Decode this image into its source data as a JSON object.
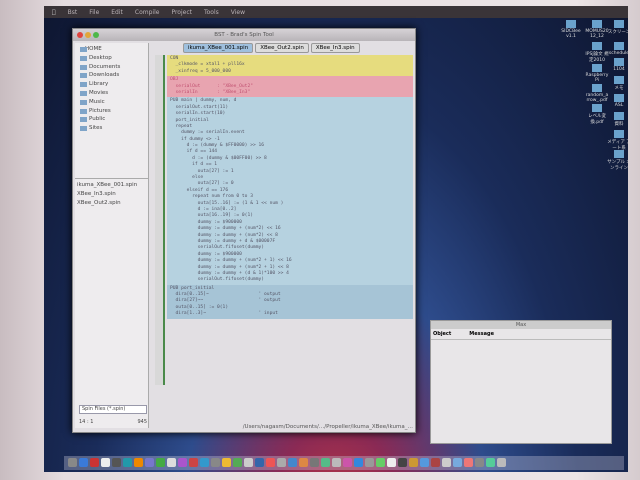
{
  "menubar": {
    "items": [
      "Bst",
      "File",
      "Edit",
      "Compile",
      "Project",
      "Tools",
      "View"
    ]
  },
  "window": {
    "title": "BST - Brad's Spin Tool",
    "tabs": [
      {
        "label": "ikuma_XBee_001.spin",
        "active": true
      },
      {
        "label": "XBee_Out2.spin"
      },
      {
        "label": "XBee_In3.spin"
      }
    ],
    "tree": {
      "root": "HOME",
      "items": [
        "Desktop",
        "Documents",
        "Downloads",
        "Library",
        "Movies",
        "Music",
        "Pictures",
        "Public",
        "Sites"
      ]
    },
    "files": [
      "ikuma_XBee_001.spin",
      "XBee_In3.spin",
      "XBee_Out2.spin"
    ],
    "filter": "Spin Files (*.spin)",
    "cursor": "14 : 1",
    "size": "945",
    "path": "/Users/nagasm/Documents/…/Propeller/ikuma_XBee/ikuma_…",
    "code": {
      "con": [
        "CON",
        "  _clkmode = xtal1 + pll16x",
        "  _xinfreq = 5_000_000"
      ],
      "obj": [
        "OBJ",
        "  serialOut      : \"XBee_Out2\"",
        "  serialIn       : \"XBee_In3\""
      ],
      "pub": [
        "PUB main | dummy, num, d",
        "  serialOut.start(11)",
        "  serialIn.start(10)",
        "  port_initial",
        "  repeat",
        "    dummy := serialIn.event",
        "    if dummy <> -1",
        "      d := (dummy & $FF0000) >> 16",
        "      if d == 144",
        "        d := (dummy & $00FF00) >> 8",
        "        if d == 1",
        "          outa[27] := 1",
        "        else",
        "          outa[27] := 0",
        "      elseif d == 176",
        "        repeat num from 0 to 3",
        "          outa[15..16] := (1 & 1 << num )",
        "          d := ina[0..2]",
        "          outa[16..19] := 0(1)",
        "          dummy := $900000",
        "          dummy := dummy + (num*2) << 16",
        "          dummy := dummy + (num*2) << 8",
        "          dummy := dummy + d & $00007F",
        "          serialOut.fifoset(dummy)",
        "          dummy := $900000",
        "          dummy := dummy + (num*2 + 1) << 16",
        "          dummy := dummy + (num*2 + 1) << 8",
        "          dummy := dummy + (d & 1)*100 >> 4",
        "          serialOut.fifoset(dummy)"
      ],
      "pri": [
        "PUB port_initial",
        "  dira[0..15]~                  ' output",
        "  dira[27]~~                    ' output",
        "  outa[0..15] := 0(1)",
        "  dira[1..3]~                   ' input"
      ]
    }
  },
  "max": {
    "title": "Max",
    "columns": [
      "Object",
      "Message"
    ]
  },
  "desktop_icons": [
    "SIDCBee v1.1",
    "MOMUS20 12_12",
    "IPSJ論文 規定2010",
    "Raspberry Pi",
    "random_a rrow_.pdf",
    "レベル変 換.pdf",
    "スクリーン",
    "schedule",
    "1104",
    "メモ",
    "ASL",
    "資料",
    "メディア アート系",
    "サンプル オンライン"
  ],
  "colors": {
    "con": "#e6dc7e",
    "obj": "#e8a4b0",
    "pub": "#b6d2e0",
    "pri": "#a6c4d6"
  }
}
